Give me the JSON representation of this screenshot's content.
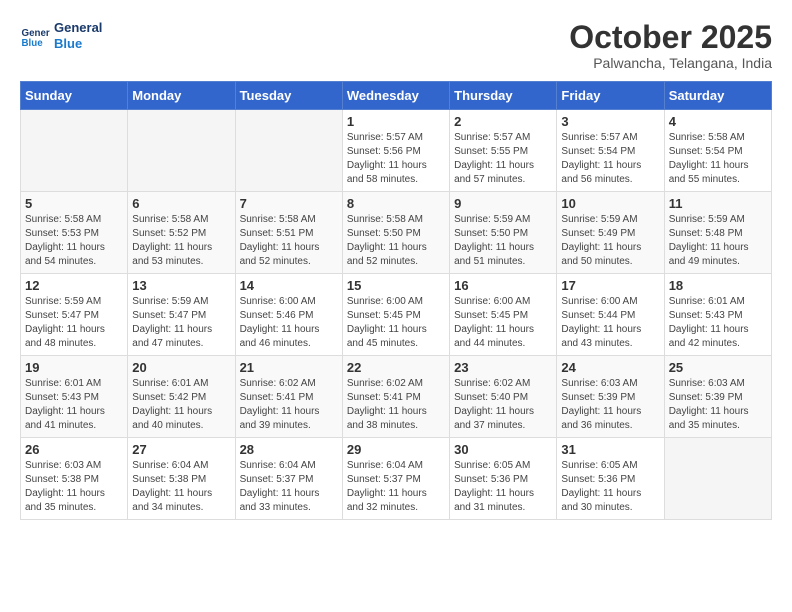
{
  "header": {
    "logo_line1": "General",
    "logo_line2": "Blue",
    "month": "October 2025",
    "location": "Palwancha, Telangana, India"
  },
  "days_of_week": [
    "Sunday",
    "Monday",
    "Tuesday",
    "Wednesday",
    "Thursday",
    "Friday",
    "Saturday"
  ],
  "weeks": [
    [
      {
        "day": "",
        "sunrise": "",
        "sunset": "",
        "daylight": ""
      },
      {
        "day": "",
        "sunrise": "",
        "sunset": "",
        "daylight": ""
      },
      {
        "day": "",
        "sunrise": "",
        "sunset": "",
        "daylight": ""
      },
      {
        "day": "1",
        "sunrise": "Sunrise: 5:57 AM",
        "sunset": "Sunset: 5:56 PM",
        "daylight": "Daylight: 11 hours and 58 minutes."
      },
      {
        "day": "2",
        "sunrise": "Sunrise: 5:57 AM",
        "sunset": "Sunset: 5:55 PM",
        "daylight": "Daylight: 11 hours and 57 minutes."
      },
      {
        "day": "3",
        "sunrise": "Sunrise: 5:57 AM",
        "sunset": "Sunset: 5:54 PM",
        "daylight": "Daylight: 11 hours and 56 minutes."
      },
      {
        "day": "4",
        "sunrise": "Sunrise: 5:58 AM",
        "sunset": "Sunset: 5:54 PM",
        "daylight": "Daylight: 11 hours and 55 minutes."
      }
    ],
    [
      {
        "day": "5",
        "sunrise": "Sunrise: 5:58 AM",
        "sunset": "Sunset: 5:53 PM",
        "daylight": "Daylight: 11 hours and 54 minutes."
      },
      {
        "day": "6",
        "sunrise": "Sunrise: 5:58 AM",
        "sunset": "Sunset: 5:52 PM",
        "daylight": "Daylight: 11 hours and 53 minutes."
      },
      {
        "day": "7",
        "sunrise": "Sunrise: 5:58 AM",
        "sunset": "Sunset: 5:51 PM",
        "daylight": "Daylight: 11 hours and 52 minutes."
      },
      {
        "day": "8",
        "sunrise": "Sunrise: 5:58 AM",
        "sunset": "Sunset: 5:50 PM",
        "daylight": "Daylight: 11 hours and 52 minutes."
      },
      {
        "day": "9",
        "sunrise": "Sunrise: 5:59 AM",
        "sunset": "Sunset: 5:50 PM",
        "daylight": "Daylight: 11 hours and 51 minutes."
      },
      {
        "day": "10",
        "sunrise": "Sunrise: 5:59 AM",
        "sunset": "Sunset: 5:49 PM",
        "daylight": "Daylight: 11 hours and 50 minutes."
      },
      {
        "day": "11",
        "sunrise": "Sunrise: 5:59 AM",
        "sunset": "Sunset: 5:48 PM",
        "daylight": "Daylight: 11 hours and 49 minutes."
      }
    ],
    [
      {
        "day": "12",
        "sunrise": "Sunrise: 5:59 AM",
        "sunset": "Sunset: 5:47 PM",
        "daylight": "Daylight: 11 hours and 48 minutes."
      },
      {
        "day": "13",
        "sunrise": "Sunrise: 5:59 AM",
        "sunset": "Sunset: 5:47 PM",
        "daylight": "Daylight: 11 hours and 47 minutes."
      },
      {
        "day": "14",
        "sunrise": "Sunrise: 6:00 AM",
        "sunset": "Sunset: 5:46 PM",
        "daylight": "Daylight: 11 hours and 46 minutes."
      },
      {
        "day": "15",
        "sunrise": "Sunrise: 6:00 AM",
        "sunset": "Sunset: 5:45 PM",
        "daylight": "Daylight: 11 hours and 45 minutes."
      },
      {
        "day": "16",
        "sunrise": "Sunrise: 6:00 AM",
        "sunset": "Sunset: 5:45 PM",
        "daylight": "Daylight: 11 hours and 44 minutes."
      },
      {
        "day": "17",
        "sunrise": "Sunrise: 6:00 AM",
        "sunset": "Sunset: 5:44 PM",
        "daylight": "Daylight: 11 hours and 43 minutes."
      },
      {
        "day": "18",
        "sunrise": "Sunrise: 6:01 AM",
        "sunset": "Sunset: 5:43 PM",
        "daylight": "Daylight: 11 hours and 42 minutes."
      }
    ],
    [
      {
        "day": "19",
        "sunrise": "Sunrise: 6:01 AM",
        "sunset": "Sunset: 5:43 PM",
        "daylight": "Daylight: 11 hours and 41 minutes."
      },
      {
        "day": "20",
        "sunrise": "Sunrise: 6:01 AM",
        "sunset": "Sunset: 5:42 PM",
        "daylight": "Daylight: 11 hours and 40 minutes."
      },
      {
        "day": "21",
        "sunrise": "Sunrise: 6:02 AM",
        "sunset": "Sunset: 5:41 PM",
        "daylight": "Daylight: 11 hours and 39 minutes."
      },
      {
        "day": "22",
        "sunrise": "Sunrise: 6:02 AM",
        "sunset": "Sunset: 5:41 PM",
        "daylight": "Daylight: 11 hours and 38 minutes."
      },
      {
        "day": "23",
        "sunrise": "Sunrise: 6:02 AM",
        "sunset": "Sunset: 5:40 PM",
        "daylight": "Daylight: 11 hours and 37 minutes."
      },
      {
        "day": "24",
        "sunrise": "Sunrise: 6:03 AM",
        "sunset": "Sunset: 5:39 PM",
        "daylight": "Daylight: 11 hours and 36 minutes."
      },
      {
        "day": "25",
        "sunrise": "Sunrise: 6:03 AM",
        "sunset": "Sunset: 5:39 PM",
        "daylight": "Daylight: 11 hours and 35 minutes."
      }
    ],
    [
      {
        "day": "26",
        "sunrise": "Sunrise: 6:03 AM",
        "sunset": "Sunset: 5:38 PM",
        "daylight": "Daylight: 11 hours and 35 minutes."
      },
      {
        "day": "27",
        "sunrise": "Sunrise: 6:04 AM",
        "sunset": "Sunset: 5:38 PM",
        "daylight": "Daylight: 11 hours and 34 minutes."
      },
      {
        "day": "28",
        "sunrise": "Sunrise: 6:04 AM",
        "sunset": "Sunset: 5:37 PM",
        "daylight": "Daylight: 11 hours and 33 minutes."
      },
      {
        "day": "29",
        "sunrise": "Sunrise: 6:04 AM",
        "sunset": "Sunset: 5:37 PM",
        "daylight": "Daylight: 11 hours and 32 minutes."
      },
      {
        "day": "30",
        "sunrise": "Sunrise: 6:05 AM",
        "sunset": "Sunset: 5:36 PM",
        "daylight": "Daylight: 11 hours and 31 minutes."
      },
      {
        "day": "31",
        "sunrise": "Sunrise: 6:05 AM",
        "sunset": "Sunset: 5:36 PM",
        "daylight": "Daylight: 11 hours and 30 minutes."
      },
      {
        "day": "",
        "sunrise": "",
        "sunset": "",
        "daylight": ""
      }
    ]
  ]
}
